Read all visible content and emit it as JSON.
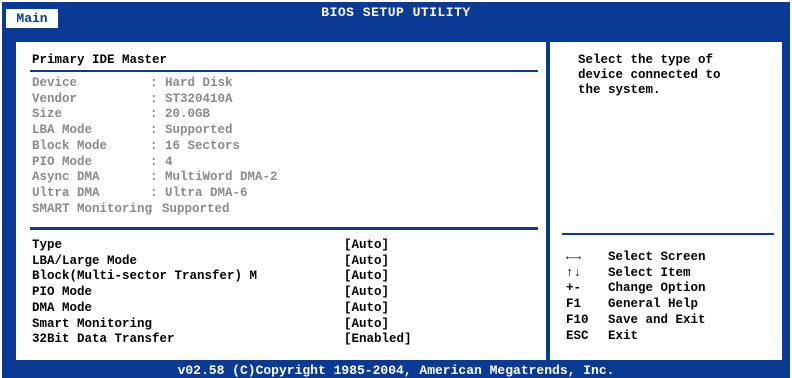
{
  "header": {
    "title": "BIOS SETUP UTILITY",
    "tab": "Main"
  },
  "section_title": "Primary IDE Master",
  "device_info": [
    {
      "label": "Device",
      "value": ": Hard Disk"
    },
    {
      "label": "Vendor",
      "value": ": ST320410A"
    },
    {
      "label": "Size",
      "value": ": 20.0GB"
    },
    {
      "label": "LBA Mode",
      "value": ": Supported"
    },
    {
      "label": "Block Mode",
      "value": ": 16 Sectors"
    },
    {
      "label": "PIO Mode",
      "value": ": 4"
    },
    {
      "label": "Async DMA",
      "value": ": MultiWord DMA-2"
    },
    {
      "label": "Ultra DMA",
      "value": ": Ultra DMA-6"
    },
    {
      "label": "SMART Monitoring",
      "value": ": Supported"
    }
  ],
  "options": [
    {
      "label": "Type",
      "value": "[Auto]"
    },
    {
      "label": "LBA/Large Mode",
      "value": "[Auto]"
    },
    {
      "label": "Block(Multi-sector Transfer) M",
      "value": "[Auto]"
    },
    {
      "label": "PIO Mode",
      "value": "[Auto]"
    },
    {
      "label": "DMA Mode",
      "value": "[Auto]"
    },
    {
      "label": "Smart Monitoring",
      "value": "[Auto]"
    },
    {
      "label": "32Bit Data Transfer",
      "value": "[Enabled]"
    }
  ],
  "help_text": [
    "Select the type of",
    "device connected to",
    "the system."
  ],
  "keys": [
    {
      "key": "←→",
      "action": "Select Screen"
    },
    {
      "key": "↑↓",
      "action": "Select Item"
    },
    {
      "key": "+-",
      "action": "Change Option"
    },
    {
      "key": "F1",
      "action": "General Help"
    },
    {
      "key": "F10",
      "action": "Save and Exit"
    },
    {
      "key": "ESC",
      "action": "Exit"
    }
  ],
  "footer": "v02.58 (C)Copyright 1985-2004, American Megatrends, Inc.",
  "colors": {
    "frame": "#0a3a94",
    "text": "#000000",
    "disabled_text": "#8a8a8a",
    "background": "#ffffff"
  }
}
